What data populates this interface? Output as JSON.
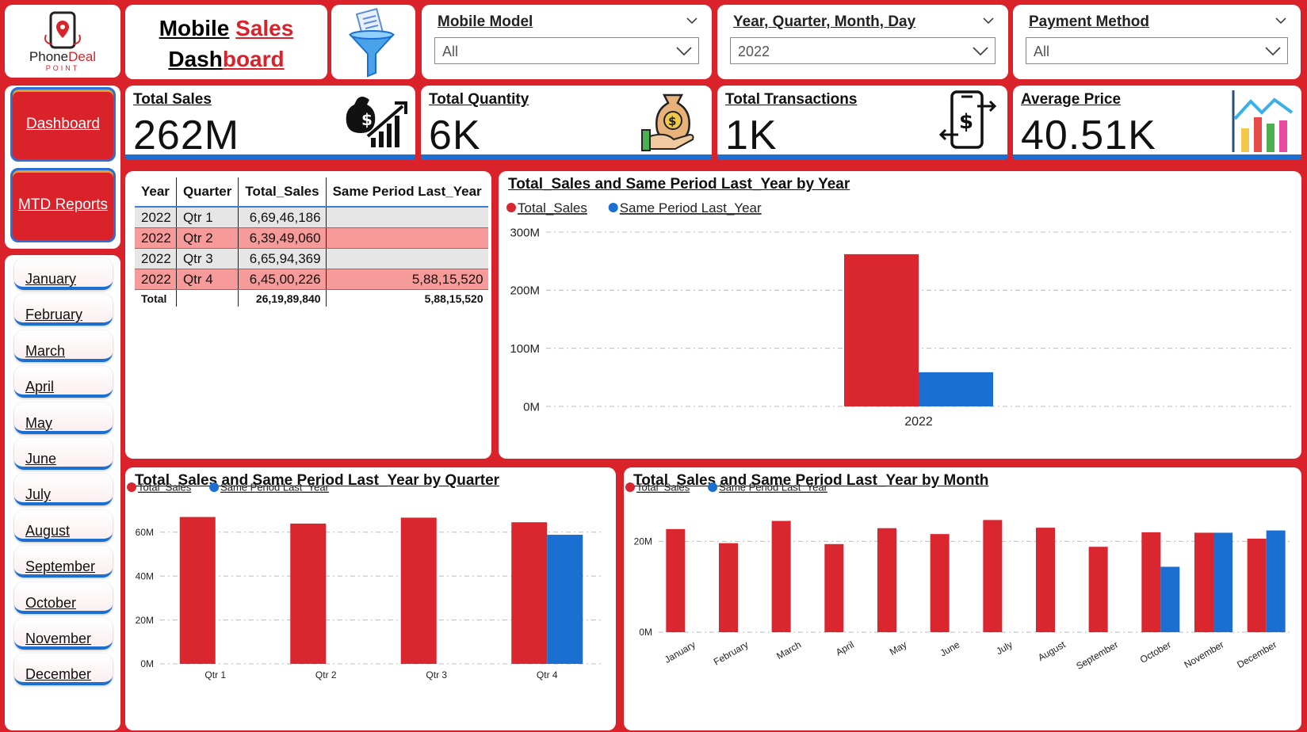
{
  "logo": {
    "brand_a": "Phone",
    "brand_b": "Deal",
    "sub": "POINT"
  },
  "title": {
    "w1": "Mobile",
    "w2": "Sales",
    "w3": "Dash",
    "w4": "board"
  },
  "slicers": {
    "model": {
      "label": "Mobile Model",
      "value": "All"
    },
    "date": {
      "label": "Year, Quarter, Month, Day",
      "value": "2022"
    },
    "payment": {
      "label": "Payment Method",
      "value": "All"
    }
  },
  "nav": {
    "dashboard": "Dashboard",
    "mtd": "MTD Reports"
  },
  "months": [
    "January",
    "February",
    "March",
    "April",
    "May",
    "June",
    "July",
    "August",
    "September",
    "October",
    "November",
    "December"
  ],
  "kpis": {
    "sales": {
      "title": "Total Sales",
      "value": "262M"
    },
    "qty": {
      "title": "Total Quantity",
      "value": "6K"
    },
    "tx": {
      "title": "Total Transactions",
      "value": "1K"
    },
    "avg": {
      "title": "Average Price",
      "value": "40.51K"
    }
  },
  "table": {
    "headers": [
      "Year",
      "Quarter",
      "Total_Sales",
      "Same Period Last_Year"
    ],
    "rows": [
      [
        "2022",
        "Qtr 1",
        "6,69,46,186",
        ""
      ],
      [
        "2022",
        "Qtr 2",
        "6,39,49,060",
        ""
      ],
      [
        "2022",
        "Qtr 3",
        "6,65,94,369",
        ""
      ],
      [
        "2022",
        "Qtr 4",
        "6,45,00,226",
        "5,88,15,520"
      ]
    ],
    "total": [
      "Total",
      "",
      "26,19,89,840",
      "5,88,15,520"
    ]
  },
  "colors": {
    "sales": "#d9262f",
    "last_year": "#1a6fd0",
    "brand": "#d9222a"
  },
  "chart_data": [
    {
      "type": "bar",
      "title": "Total_Sales and Same Period Last_Year by Year",
      "categories": [
        "2022"
      ],
      "series": [
        {
          "name": "Total_Sales",
          "values": [
            262
          ]
        },
        {
          "name": "Same Period Last_Year",
          "values": [
            58.8
          ]
        }
      ],
      "yticks": [
        "0M",
        "100M",
        "200M",
        "300M"
      ],
      "ylim": [
        0,
        300
      ],
      "legend": "top-left",
      "grid": true
    },
    {
      "type": "bar",
      "title": "Total_Sales and Same Period Last_Year by Quarter",
      "categories": [
        "Qtr 1",
        "Qtr 2",
        "Qtr 3",
        "Qtr 4"
      ],
      "series": [
        {
          "name": "Total_Sales",
          "values": [
            66.9,
            63.9,
            66.6,
            64.5
          ]
        },
        {
          "name": "Same Period Last_Year",
          "values": [
            0,
            0,
            0,
            58.8
          ]
        }
      ],
      "yticks": [
        "0M",
        "20M",
        "40M",
        "60M"
      ],
      "ylim": [
        0,
        70
      ],
      "legend": "top-left",
      "grid": true
    },
    {
      "type": "bar",
      "title": "Total_Sales and Same Period Last_Year by Month",
      "categories": [
        "January",
        "February",
        "March",
        "April",
        "May",
        "June",
        "July",
        "August",
        "September",
        "October",
        "November",
        "December"
      ],
      "series": [
        {
          "name": "Total_Sales",
          "values": [
            22.7,
            19.6,
            24.5,
            19.4,
            22.9,
            21.6,
            24.7,
            23.0,
            18.8,
            22.0,
            21.9,
            20.6
          ]
        },
        {
          "name": "Same Period Last_Year",
          "values": [
            0,
            0,
            0,
            0,
            0,
            0,
            0,
            0,
            0,
            14.4,
            21.9,
            22.4
          ]
        }
      ],
      "yticks": [
        "0M",
        "20M"
      ],
      "ylim": [
        0,
        30
      ],
      "legend": "top-left",
      "grid": true
    }
  ]
}
